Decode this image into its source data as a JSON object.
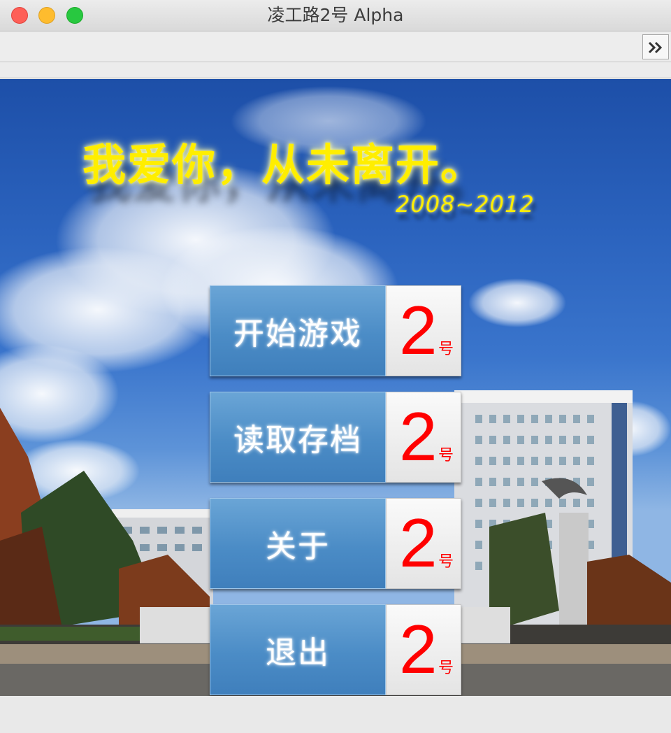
{
  "window": {
    "title": "凌工路2号 Alpha"
  },
  "toolbar": {
    "expand_icon": "double-chevron-right-icon"
  },
  "scene": {
    "slogan": "我爱你，从未离开。",
    "years": "2008~2012"
  },
  "menu": [
    {
      "label": "开始游戏",
      "num": "2",
      "suffix": "号"
    },
    {
      "label": "读取存档",
      "num": "2",
      "suffix": "号"
    },
    {
      "label": "关于",
      "num": "2",
      "suffix": "号"
    },
    {
      "label": "退出",
      "num": "2",
      "suffix": "号"
    }
  ],
  "colors": {
    "slogan": "#ffee00",
    "number": "#ff0000",
    "button_blue": "#4b8cc6"
  }
}
